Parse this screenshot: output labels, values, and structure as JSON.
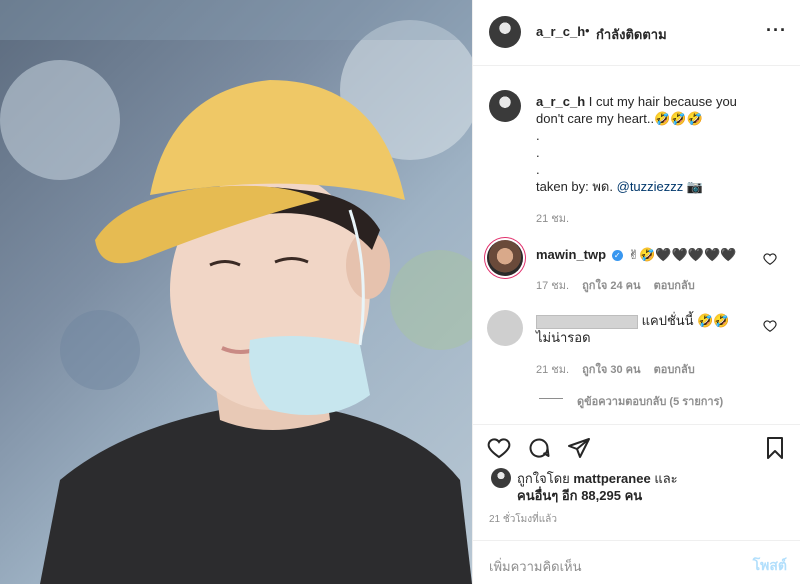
{
  "header": {
    "username": "a_r_c_h",
    "separator": "•",
    "follow_status": "กำลังติดตาม",
    "more_icon": "more-options-icon"
  },
  "caption": {
    "username": "a_r_c_h",
    "text_line1": "I cut my hair because you",
    "text_line2": "don't care my heart..🤣🤣🤣",
    "dot1": ".",
    "dot2": ".",
    "dot3": ".",
    "taken_by_label": "taken by: พด.",
    "taken_by_handle": "@tuzziezzz",
    "camera_emoji": "📷",
    "time": "21 ชม."
  },
  "comments": [
    {
      "username": "mawin_twp",
      "text": "✌🤣🖤🖤🖤🖤🖤",
      "time": "17 ชม.",
      "likes": "ถูกใจ 24 คน",
      "reply": "ตอบกลับ"
    },
    {
      "username": "",
      "text_line1": "แคปชั่นนี้ 🤣🤣",
      "text_line2": "ไม่น่ารอด",
      "time": "21 ชม.",
      "likes": "ถูกใจ 30 คน",
      "reply": "ตอบกลับ"
    }
  ],
  "view_replies": "ดูข้อความตอบกลับ (5 รายการ)",
  "actions": {
    "like_icon": "heart-icon",
    "comment_icon": "comment-icon",
    "share_icon": "share-icon",
    "save_icon": "bookmark-icon"
  },
  "likes": {
    "prefix": "ถูกใจโดย",
    "user": "mattperanee",
    "and": "และ",
    "others_label": "คนอื่นๆ อีก",
    "others_count": "88,295",
    "suffix": "คน"
  },
  "posted_ago": "21 ชั่วโมงที่แล้ว",
  "comment_box": {
    "placeholder": "เพิ่มความคิดเห็น",
    "post_label": "โพสต์"
  }
}
